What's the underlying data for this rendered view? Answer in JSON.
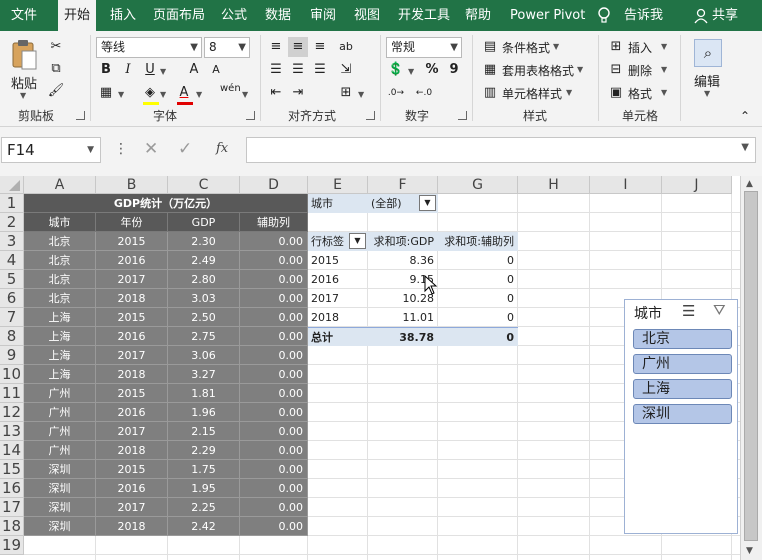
{
  "tabs": [
    "文件",
    "开始",
    "插入",
    "页面布局",
    "公式",
    "数据",
    "审阅",
    "视图",
    "开发工具",
    "帮助",
    "Power Pivot",
    "告诉我",
    "共享"
  ],
  "ribbon": {
    "clipboard": {
      "paste": "粘贴",
      "label": "剪贴板"
    },
    "font": {
      "name": "等线",
      "size": "8",
      "bold": "B",
      "italic": "I",
      "underline": "U",
      "grow": "A",
      "shrink": "A",
      "phonetic": "wén",
      "label": "字体"
    },
    "align": {
      "label": "对齐方式"
    },
    "number": {
      "format": "常规",
      "percent": "%",
      "comma": "9",
      "label": "数字"
    },
    "styles": {
      "conditional": "条件格式",
      "table": "套用表格格式",
      "cell": "单元格样式",
      "label": "样式"
    },
    "cells": {
      "insert": "插入",
      "delete": "删除",
      "format": "格式",
      "label": "单元格"
    },
    "editing": {
      "label": "编辑"
    }
  },
  "formula_bar": {
    "name_box": "F14",
    "formula": ""
  },
  "columns": [
    "A",
    "B",
    "C",
    "D",
    "E",
    "F",
    "G",
    "H",
    "I",
    "J"
  ],
  "rows": [
    "1",
    "2",
    "3",
    "4",
    "5",
    "6",
    "7",
    "8",
    "9",
    "10",
    "11",
    "12",
    "13",
    "14",
    "15",
    "16",
    "17",
    "18",
    "19"
  ],
  "source_table": {
    "title": "GDP统计（万亿元）",
    "headers": [
      "城市",
      "年份",
      "GDP",
      "辅助列"
    ],
    "rows": [
      [
        "北京",
        "2015",
        "2.30",
        "0.00"
      ],
      [
        "北京",
        "2016",
        "2.49",
        "0.00"
      ],
      [
        "北京",
        "2017",
        "2.80",
        "0.00"
      ],
      [
        "北京",
        "2018",
        "3.03",
        "0.00"
      ],
      [
        "上海",
        "2015",
        "2.50",
        "0.00"
      ],
      [
        "上海",
        "2016",
        "2.75",
        "0.00"
      ],
      [
        "上海",
        "2017",
        "3.06",
        "0.00"
      ],
      [
        "上海",
        "2018",
        "3.27",
        "0.00"
      ],
      [
        "广州",
        "2015",
        "1.81",
        "0.00"
      ],
      [
        "广州",
        "2016",
        "1.96",
        "0.00"
      ],
      [
        "广州",
        "2017",
        "2.15",
        "0.00"
      ],
      [
        "广州",
        "2018",
        "2.29",
        "0.00"
      ],
      [
        "深圳",
        "2015",
        "1.75",
        "0.00"
      ],
      [
        "深圳",
        "2016",
        "1.95",
        "0.00"
      ],
      [
        "深圳",
        "2017",
        "2.25",
        "0.00"
      ],
      [
        "深圳",
        "2018",
        "2.42",
        "0.00"
      ]
    ]
  },
  "pivot": {
    "filter_label": "城市",
    "filter_value": "(全部)",
    "row_label": "行标签",
    "col_gdp": "求和项:GDP",
    "col_aux": "求和项:辅助列",
    "rows": [
      [
        "2015",
        "8.36",
        "0"
      ],
      [
        "2016",
        "9.15",
        "0"
      ],
      [
        "2017",
        "10.28",
        "0"
      ],
      [
        "2018",
        "11.01",
        "0"
      ]
    ],
    "total": [
      "总计",
      "38.78",
      "0"
    ]
  },
  "slicer": {
    "title": "城市",
    "items": [
      "北京",
      "广州",
      "上海",
      "深圳"
    ]
  },
  "colors": {
    "excel_green": "#217346",
    "slicer_item": "#b4c6e7",
    "pivot_blue": "#dce6f1",
    "source_fill": "#7f7f7f"
  }
}
